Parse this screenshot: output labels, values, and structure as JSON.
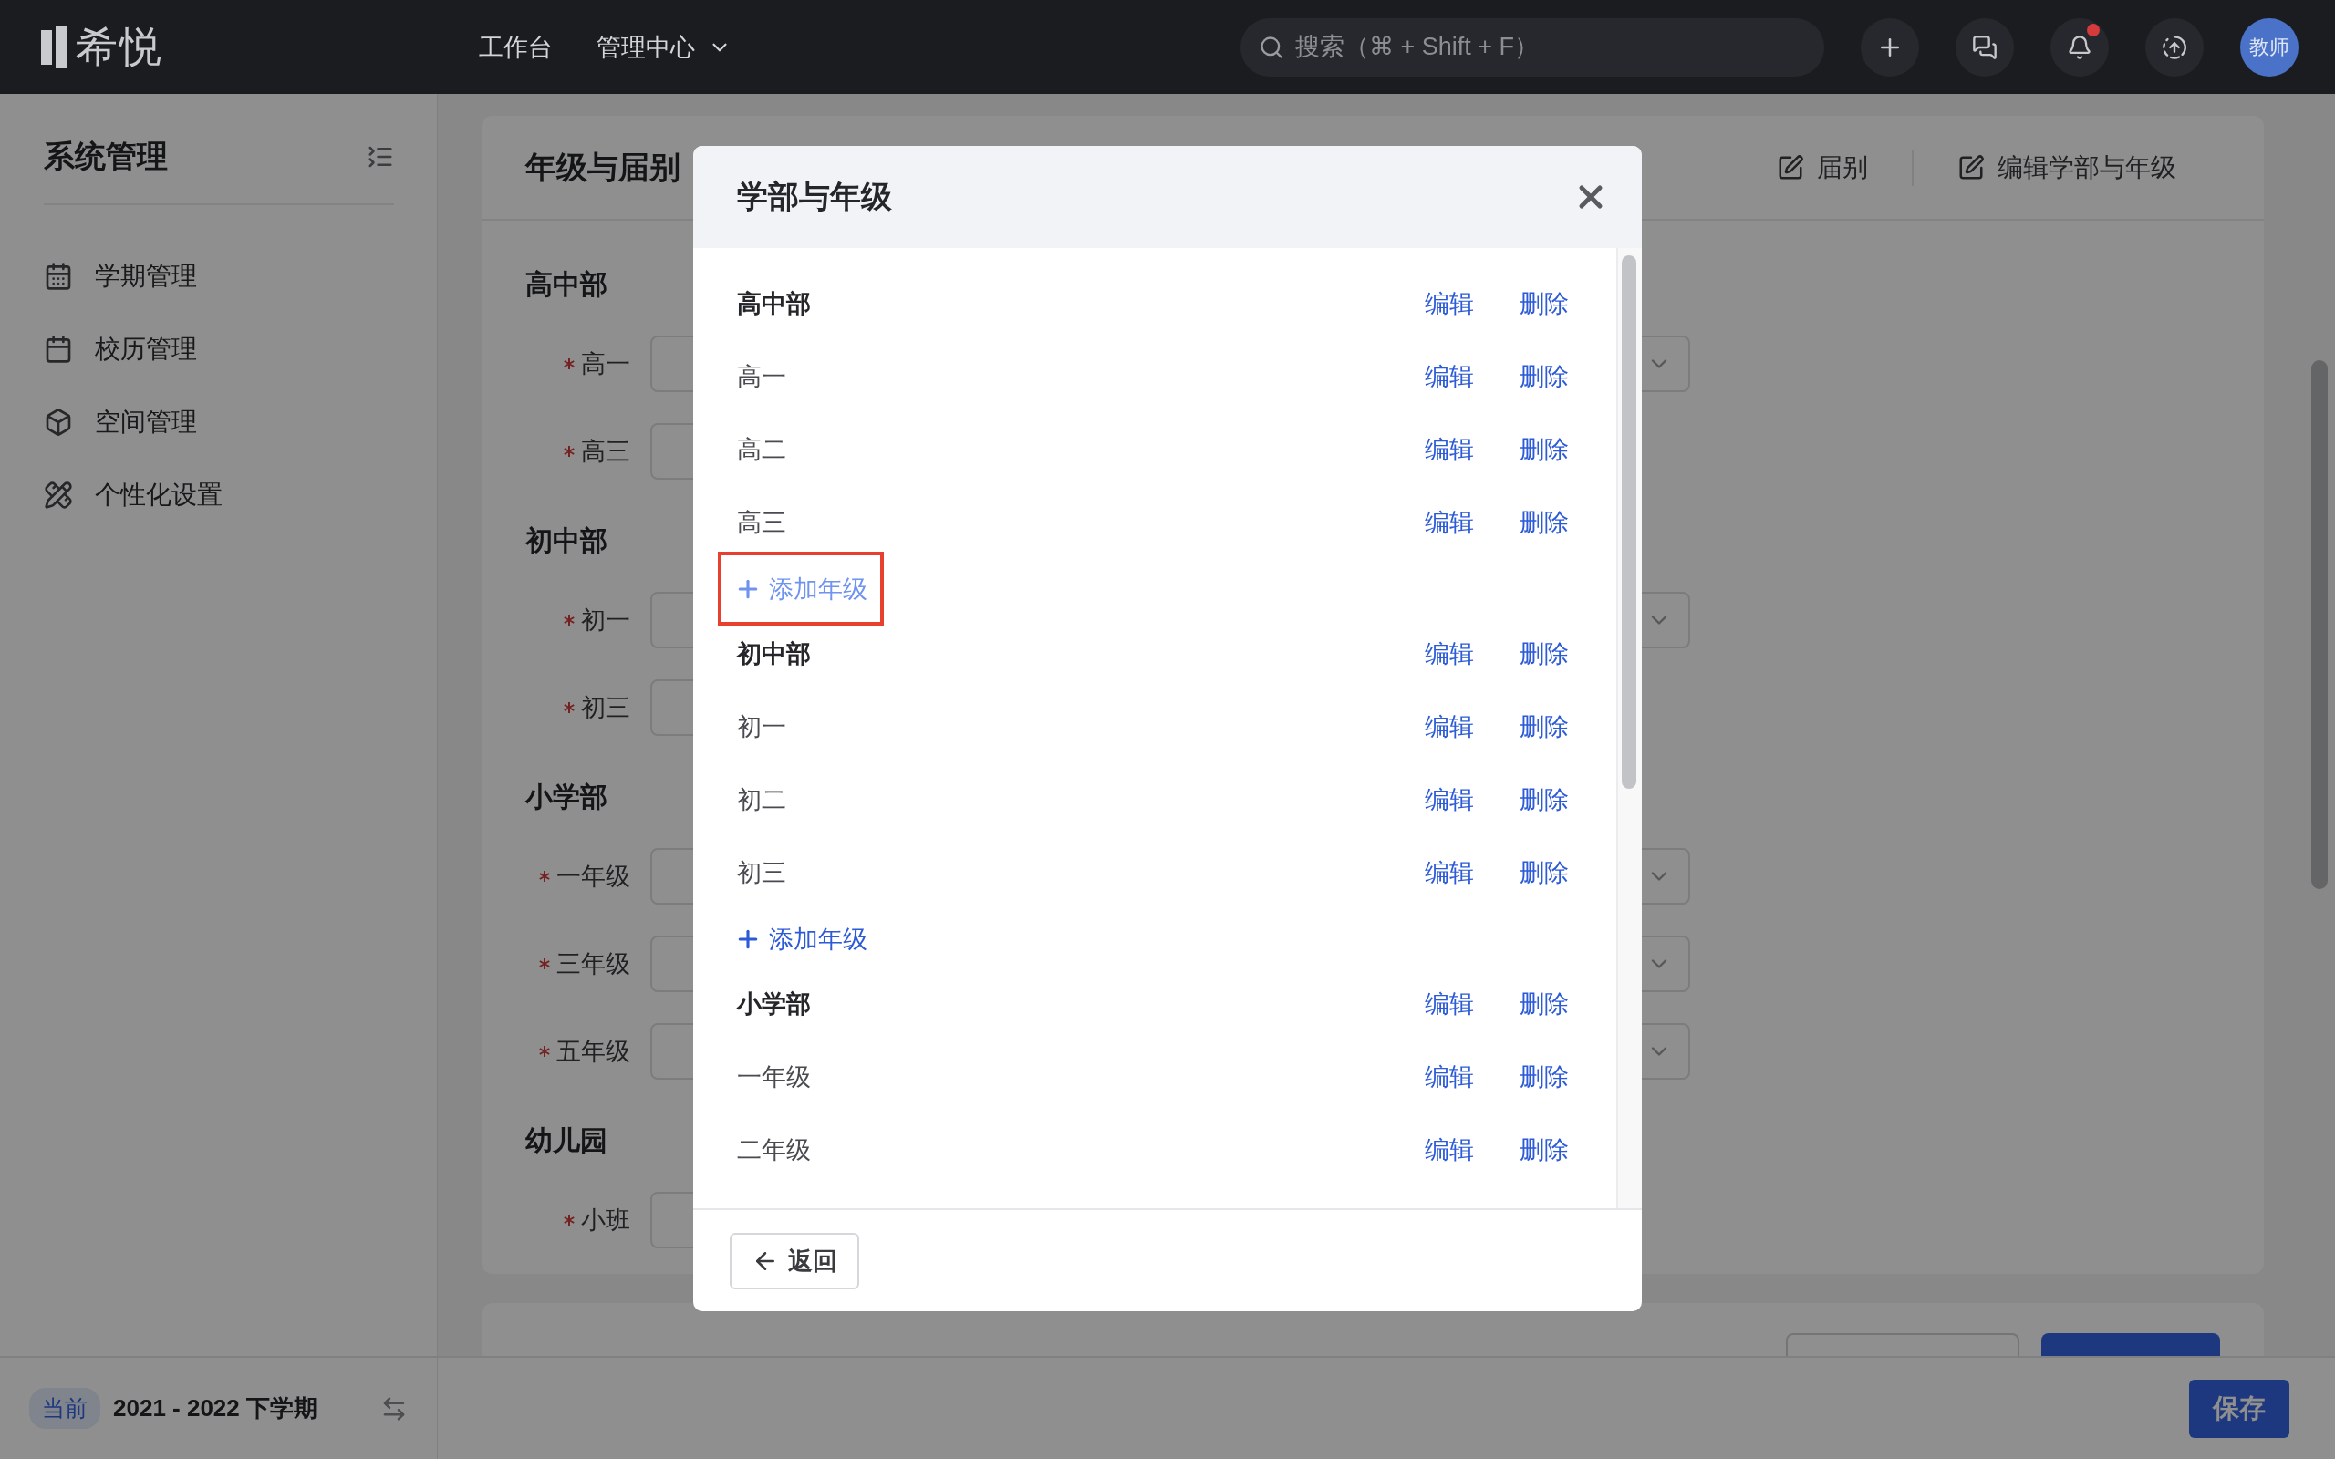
{
  "top_bar": {
    "logo": "希悦",
    "nav": [
      {
        "label": "工作台",
        "kind": "link"
      },
      {
        "label": "管理中心",
        "kind": "dropdown"
      }
    ],
    "search": {
      "placeholder": "搜索（⌘ + Shift + F）"
    },
    "unread_notifications": true,
    "avatar": "教师"
  },
  "sidebar": {
    "title": "系统管理",
    "items": [
      {
        "label": "学期管理"
      },
      {
        "label": "校历管理"
      },
      {
        "label": "空间管理"
      },
      {
        "label": "个性化设置"
      }
    ]
  },
  "page": {
    "title": "年级与届别",
    "actions": [
      "届别",
      "编辑学部与年级"
    ],
    "sections": [
      {
        "title": "高中部",
        "fields": [
          {
            "label": "高一",
            "required": true,
            "kind": "select"
          },
          {
            "label": "高三",
            "required": true,
            "kind": "input"
          }
        ]
      },
      {
        "title": "初中部",
        "fields": [
          {
            "label": "初一",
            "required": true,
            "kind": "select"
          },
          {
            "label": "初三",
            "required": true,
            "kind": "input"
          }
        ]
      },
      {
        "title": "小学部",
        "fields": [
          {
            "label": "一年级",
            "required": true,
            "kind": "select"
          },
          {
            "label": "三年级",
            "required": true,
            "kind": "select"
          },
          {
            "label": "五年级",
            "required": true,
            "kind": "select"
          }
        ]
      },
      {
        "title": "幼儿园",
        "fields": [
          {
            "label": "小班",
            "required": true,
            "kind": "input"
          }
        ]
      }
    ],
    "next_card": {
      "kind": "card"
    }
  },
  "term_bar": {
    "tag": "当前",
    "term": "2021 - 2022 下学期",
    "save_button": "保存"
  },
  "dialog": {
    "title": "学部与年级",
    "groups": [
      {
        "name": "高中部",
        "edit": "编辑",
        "delete": "删除",
        "grades": [
          {
            "name": "高一",
            "edit": "编辑",
            "delete": "删除"
          },
          {
            "name": "高二",
            "edit": "编辑",
            "delete": "删除"
          },
          {
            "name": "高三",
            "edit": "编辑",
            "delete": "删除"
          }
        ],
        "add": {
          "label": "添加年级",
          "highlighted": true
        }
      },
      {
        "name": "初中部",
        "edit": "编辑",
        "delete": "删除",
        "grades": [
          {
            "name": "初一",
            "edit": "编辑",
            "delete": "删除"
          },
          {
            "name": "初二",
            "edit": "编辑",
            "delete": "删除"
          },
          {
            "name": "初三",
            "edit": "编辑",
            "delete": "删除"
          }
        ],
        "add": {
          "label": "添加年级",
          "highlighted": false
        }
      },
      {
        "name": "小学部",
        "edit": "编辑",
        "delete": "删除",
        "grades": [
          {
            "name": "一年级",
            "edit": "编辑",
            "delete": "删除"
          },
          {
            "name": "二年级",
            "edit": "编辑",
            "delete": "删除"
          }
        ]
      }
    ],
    "back_button": "返回"
  }
}
